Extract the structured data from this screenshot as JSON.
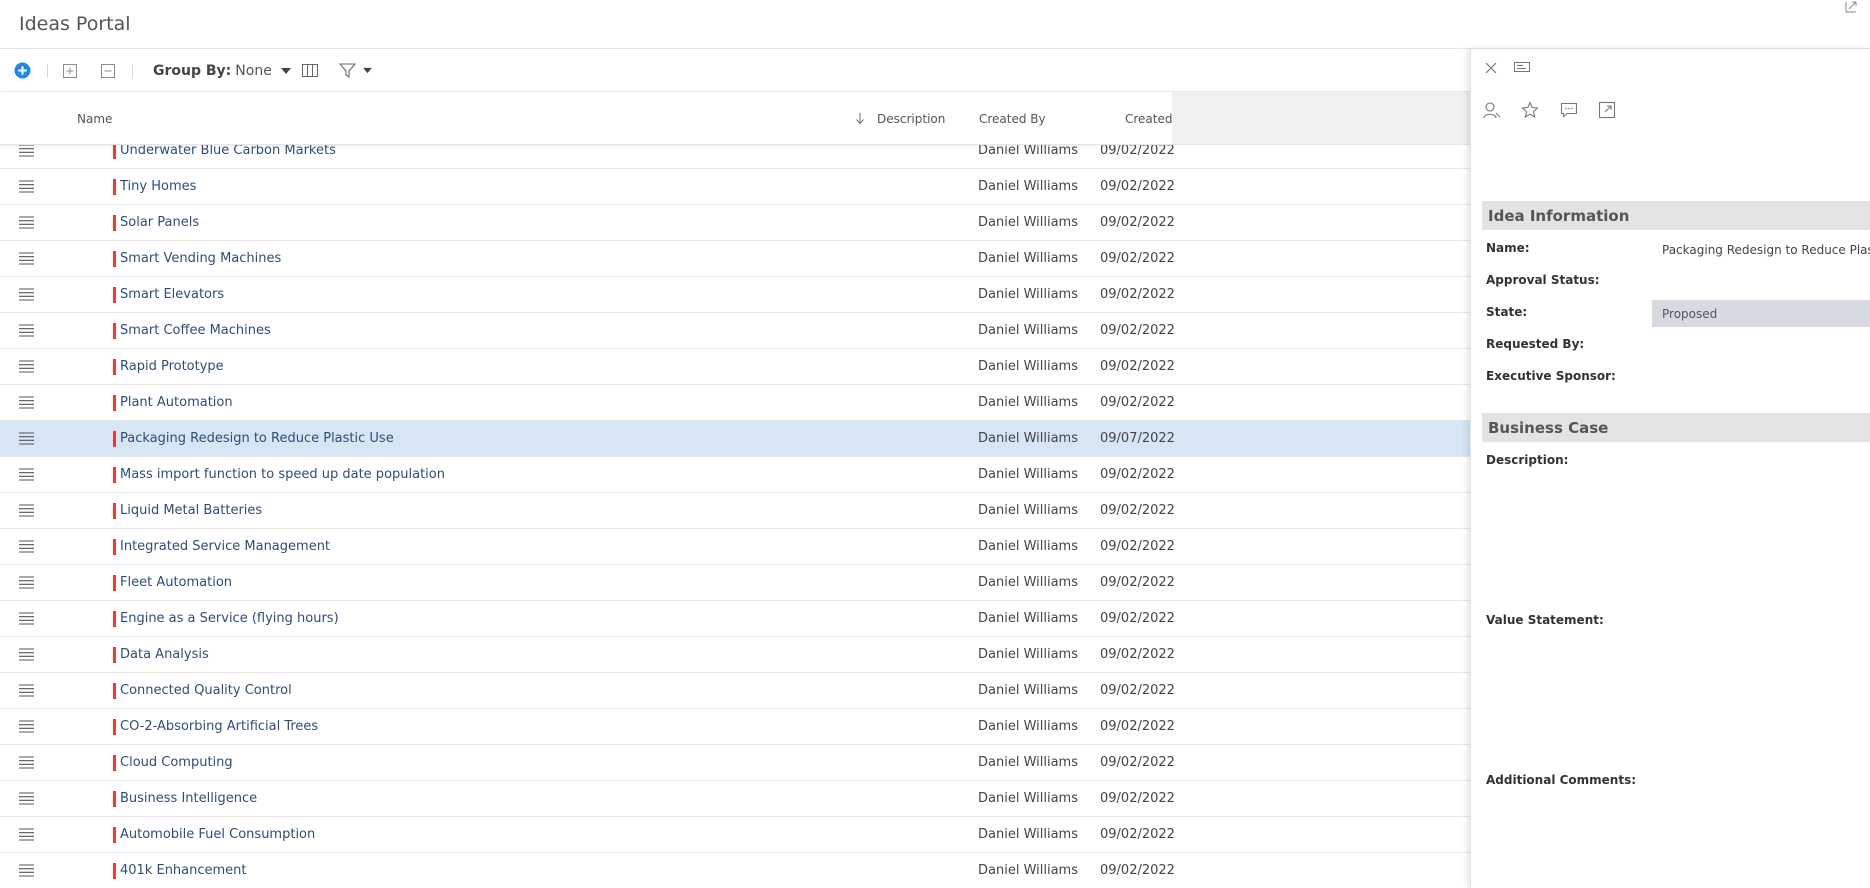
{
  "app": {
    "title": "Ideas Portal"
  },
  "toolbar": {
    "add_icon": "plus-circle-icon",
    "expand_all_icon": "plus-square-icon",
    "collapse_all_icon": "minus-square-icon",
    "group_by_label": "Group By:",
    "group_by_value": "None",
    "columns_icon": "columns-icon",
    "filter_icon": "filter-icon",
    "accent": "#1e88e5"
  },
  "grid": {
    "columns": {
      "name": "Name",
      "description": "Description",
      "created_by": "Created By",
      "created": "Created"
    },
    "sort_column": "Description",
    "rows": [
      {
        "name": "Underwater Blue Carbon Markets",
        "created_by": "Daniel Williams",
        "created": "09/02/2022"
      },
      {
        "name": "Tiny Homes",
        "created_by": "Daniel Williams",
        "created": "09/02/2022"
      },
      {
        "name": "Solar Panels",
        "created_by": "Daniel Williams",
        "created": "09/02/2022"
      },
      {
        "name": "Smart Vending Machines",
        "created_by": "Daniel Williams",
        "created": "09/02/2022"
      },
      {
        "name": "Smart Elevators",
        "created_by": "Daniel Williams",
        "created": "09/02/2022"
      },
      {
        "name": "Smart Coffee Machines",
        "created_by": "Daniel Williams",
        "created": "09/02/2022"
      },
      {
        "name": "Rapid Prototype",
        "created_by": "Daniel Williams",
        "created": "09/02/2022"
      },
      {
        "name": "Plant Automation",
        "created_by": "Daniel Williams",
        "created": "09/02/2022"
      },
      {
        "name": "Packaging Redesign to Reduce Plastic Use",
        "created_by": "Daniel Williams",
        "created": "09/07/2022",
        "selected": true
      },
      {
        "name": "Mass import function to speed up date population",
        "created_by": "Daniel Williams",
        "created": "09/02/2022"
      },
      {
        "name": "Liquid Metal Batteries",
        "created_by": "Daniel Williams",
        "created": "09/02/2022"
      },
      {
        "name": "Integrated Service Management",
        "created_by": "Daniel Williams",
        "created": "09/02/2022"
      },
      {
        "name": "Fleet Automation",
        "created_by": "Daniel Williams",
        "created": "09/02/2022"
      },
      {
        "name": "Engine as a Service (flying hours)",
        "created_by": "Daniel Williams",
        "created": "09/02/2022"
      },
      {
        "name": "Data Analysis",
        "created_by": "Daniel Williams",
        "created": "09/02/2022"
      },
      {
        "name": "Connected Quality Control",
        "created_by": "Daniel Williams",
        "created": "09/02/2022"
      },
      {
        "name": "CO-2-Absorbing Artificial Trees",
        "created_by": "Daniel Williams",
        "created": "09/02/2022"
      },
      {
        "name": "Cloud Computing",
        "created_by": "Daniel Williams",
        "created": "09/02/2022"
      },
      {
        "name": "Business Intelligence",
        "created_by": "Daniel Williams",
        "created": "09/02/2022"
      },
      {
        "name": "Automobile Fuel Consumption",
        "created_by": "Daniel Williams",
        "created": "09/02/2022"
      },
      {
        "name": "401k Enhancement",
        "created_by": "Daniel Williams",
        "created": "09/02/2022"
      }
    ],
    "flag_color": "#e0403a",
    "selected_row_color": "#d6e6f5"
  },
  "detail": {
    "sections": {
      "idea_information": "Idea Information",
      "business_case": "Business Case"
    },
    "fields": {
      "name_label": "Name:",
      "name_value": "Packaging Redesign to Reduce Plastic Us",
      "approval_status_label": "Approval Status:",
      "state_label": "State:",
      "state_value": "Proposed",
      "requested_by_label": "Requested By:",
      "executive_sponsor_label": "Executive Sponsor:",
      "description_label": "Description:",
      "value_statement_label": "Value Statement:",
      "additional_comments_label": "Additional Comments:"
    }
  }
}
